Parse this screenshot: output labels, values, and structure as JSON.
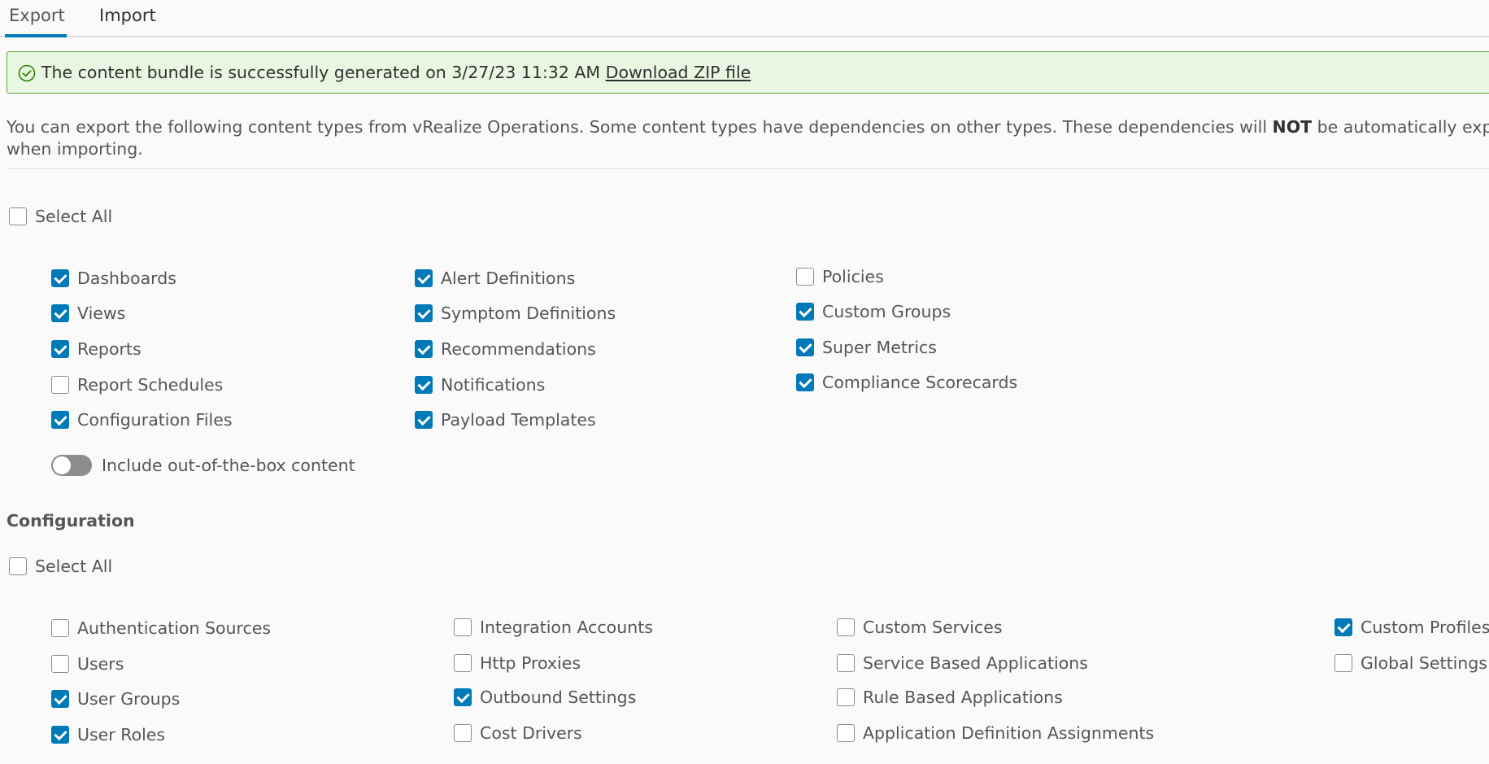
{
  "tabs": [
    {
      "label": "Export",
      "active": true
    },
    {
      "label": "Import",
      "active": false
    }
  ],
  "alert": {
    "icon": "success-check-circle-icon",
    "message": "The content bundle is successfully generated on 3/27/23 11:32 AM",
    "link": "Download ZIP file",
    "colors": {
      "background": "#e9f6e1",
      "border": "#5ea53a"
    }
  },
  "description": {
    "part1": "You can export the following content types from vRealize Operations. Some content types have dependencies on other types. These dependencies will ",
    "emphasis": "NOT",
    "part2": " be automatically exporte",
    "line2": "when importing."
  },
  "content": {
    "select_all_label": "Select All",
    "select_all_checked": false,
    "columns": [
      [
        {
          "label": "Dashboards",
          "checked": true
        },
        {
          "label": "Views",
          "checked": true
        },
        {
          "label": "Reports",
          "checked": true
        },
        {
          "label": "Report Schedules",
          "checked": false
        },
        {
          "label": "Configuration Files",
          "checked": true
        }
      ],
      [
        {
          "label": "Alert Definitions",
          "checked": true
        },
        {
          "label": "Symptom Definitions",
          "checked": true
        },
        {
          "label": "Recommendations",
          "checked": true
        },
        {
          "label": "Notifications",
          "checked": true
        },
        {
          "label": "Payload Templates",
          "checked": true
        }
      ],
      [
        {
          "label": "Policies",
          "checked": false
        },
        {
          "label": "Custom Groups",
          "checked": true
        },
        {
          "label": "Super Metrics",
          "checked": true
        },
        {
          "label": "Compliance Scorecards",
          "checked": true
        }
      ]
    ],
    "toggle_label": "Include out-of-the-box content",
    "toggle_on": false
  },
  "configuration": {
    "title": "Configuration",
    "select_all_label": "Select All",
    "select_all_checked": false,
    "columns": [
      [
        {
          "label": "Authentication Sources",
          "checked": false
        },
        {
          "label": "Users",
          "checked": false
        },
        {
          "label": "User Groups",
          "checked": true
        },
        {
          "label": "User Roles",
          "checked": true
        }
      ],
      [
        {
          "label": "Integration Accounts",
          "checked": false
        },
        {
          "label": "Http Proxies",
          "checked": false
        },
        {
          "label": "Outbound Settings",
          "checked": true
        },
        {
          "label": "Cost Drivers",
          "checked": false
        }
      ],
      [
        {
          "label": "Custom Services",
          "checked": false
        },
        {
          "label": "Service Based Applications",
          "checked": false
        },
        {
          "label": "Rule Based Applications",
          "checked": false
        },
        {
          "label": "Application Definition Assignments",
          "checked": false
        }
      ],
      [
        {
          "label": "Custom Profiles",
          "checked": true
        },
        {
          "label": "Global Settings",
          "checked": false
        }
      ]
    ]
  },
  "colors": {
    "accent": "#0079b8",
    "text": "#565656",
    "divider": "#dddddd"
  }
}
